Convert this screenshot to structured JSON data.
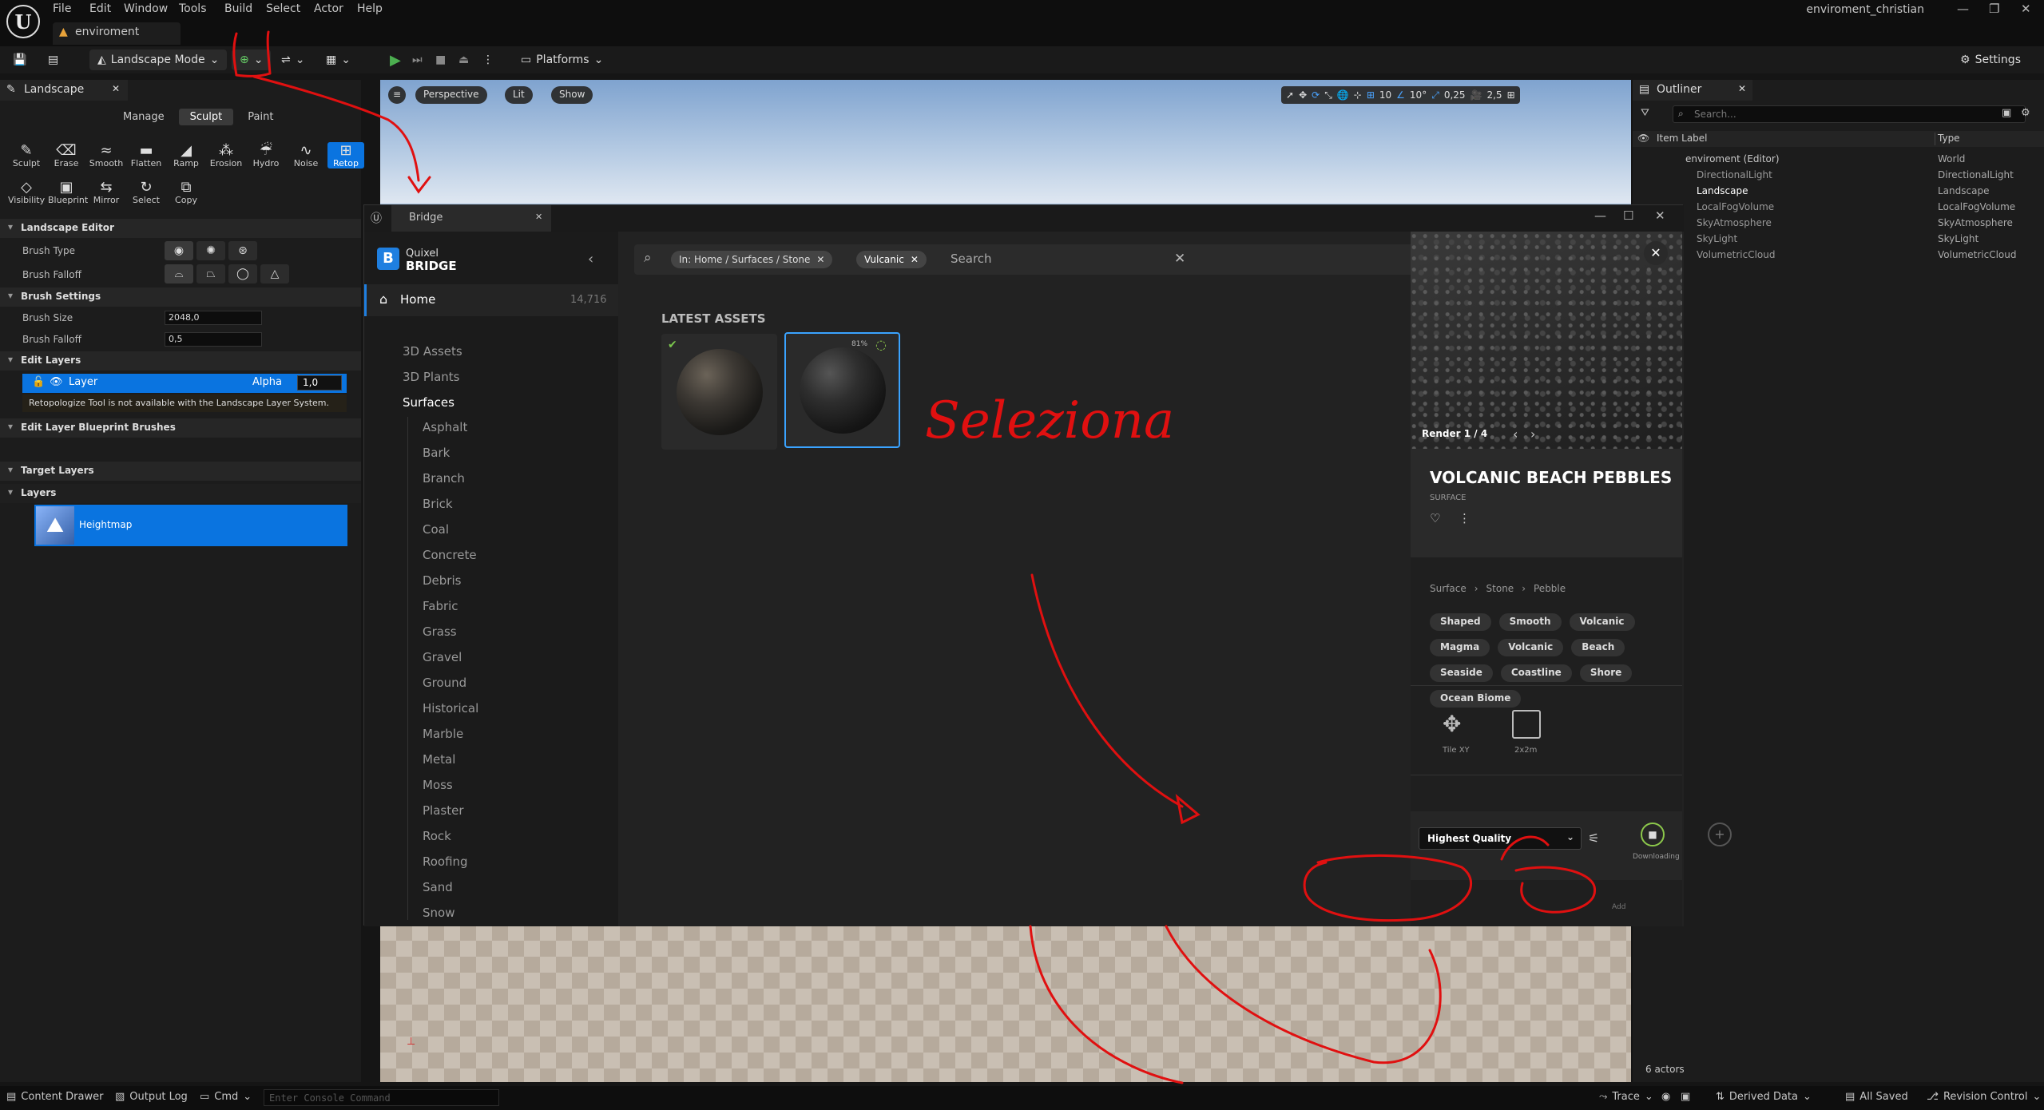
{
  "menu": {
    "items": [
      "File",
      "Edit",
      "Window",
      "Tools",
      "Build",
      "Select",
      "Actor",
      "Help"
    ],
    "doc_tab": "enviroment",
    "project": "enviroment_christian"
  },
  "toolbar": {
    "mode": "Landscape Mode",
    "platforms": "Platforms",
    "settings": "Settings"
  },
  "landscape_panel": {
    "tab": "Landscape",
    "modes": [
      "Manage",
      "Sculpt",
      "Paint"
    ],
    "tools_row1": [
      "Sculpt",
      "Erase",
      "Smooth",
      "Flatten",
      "Ramp",
      "Erosion",
      "Hydro",
      "Noise",
      "Retop"
    ],
    "tools_row2": [
      "Visibility",
      "Blueprint",
      "Mirror",
      "Select",
      "Copy"
    ],
    "landscape_editor": "Landscape Editor",
    "brush_type": "Brush Type",
    "brush_falloff_label": "Brush Falloff",
    "brush_settings": "Brush Settings",
    "brush_size_label": "Brush Size",
    "brush_size": "2048,0",
    "brush_falloff2_label": "Brush Falloff",
    "brush_falloff": "0,5",
    "edit_layers": "Edit Layers",
    "layer_name": "Layer",
    "alpha_label": "Alpha",
    "alpha_value": "1,0",
    "warning": "Retopologize Tool is not available with the Landscape Layer System.",
    "edit_bp_brushes": "Edit Layer Blueprint Brushes",
    "target_layers": "Target Layers",
    "layers": "Layers",
    "heightmap": "Heightmap"
  },
  "viewport": {
    "perspective": "Perspective",
    "lit": "Lit",
    "show": "Show",
    "grid": "10",
    "angle": "10°",
    "scale": "0,25",
    "cam_speed": "2,5"
  },
  "outliner": {
    "tab": "Outliner",
    "search_placeholder": "Search...",
    "col_label": "Item Label",
    "col_type": "Type",
    "rows": [
      {
        "label": "enviroment (Editor)",
        "type": "World"
      },
      {
        "label": "DirectionalLight",
        "type": "DirectionalLight"
      },
      {
        "label": "Landscape",
        "type": "Landscape"
      },
      {
        "label": "LocalFogVolume",
        "type": "LocalFogVolume"
      },
      {
        "label": "SkyAtmosphere",
        "type": "SkyAtmosphere"
      },
      {
        "label": "SkyLight",
        "type": "SkyLight"
      },
      {
        "label": "VolumetricCloud",
        "type": "VolumetricCloud"
      }
    ],
    "actors": "6 actors"
  },
  "statusbar": {
    "content_drawer": "Content Drawer",
    "output_log": "Output Log",
    "cmd": "Cmd",
    "console_placeholder": "Enter Console Command",
    "trace": "Trace",
    "derived_data": "Derived Data",
    "all_saved": "All Saved",
    "revision_control": "Revision Control"
  },
  "bridge": {
    "tab": "Bridge",
    "logo_top": "Quixel",
    "logo_bottom": "BRIDGE",
    "home": "Home",
    "home_count": "14,716",
    "categories": [
      "3D Assets",
      "3D Plants",
      "Surfaces"
    ],
    "surfaces": [
      "Asphalt",
      "Bark",
      "Branch",
      "Brick",
      "Coal",
      "Concrete",
      "Debris",
      "Fabric",
      "Grass",
      "Gravel",
      "Ground",
      "Historical",
      "Marble",
      "Metal",
      "Moss",
      "Plaster",
      "Rock",
      "Roofing",
      "Sand",
      "Snow"
    ],
    "chip_path": "In: Home / Surfaces / Stone",
    "chip_filter": "Vulcanic",
    "search_placeholder": "Search",
    "latest_assets": "LATEST ASSETS",
    "card2_badge": "81%",
    "render": "Render 1 / 4",
    "asset_title": "VOLCANIC BEACH PEBBLES",
    "asset_type": "SURFACE",
    "breadcrumb": [
      "Surface",
      "Stone",
      "Pebble"
    ],
    "tags": [
      "Shaped",
      "Smooth",
      "Volcanic",
      "Magma",
      "Volcanic",
      "Beach",
      "Seaside",
      "Coastline",
      "Shore",
      "Ocean Biome"
    ],
    "tile_label": "Tile XY",
    "size_label": "2x2m",
    "quality": "Highest Quality",
    "downloading": "Downloading",
    "add": "Add"
  },
  "annotation": {
    "handwritten": "Seleziona",
    "color": "#e01010"
  }
}
